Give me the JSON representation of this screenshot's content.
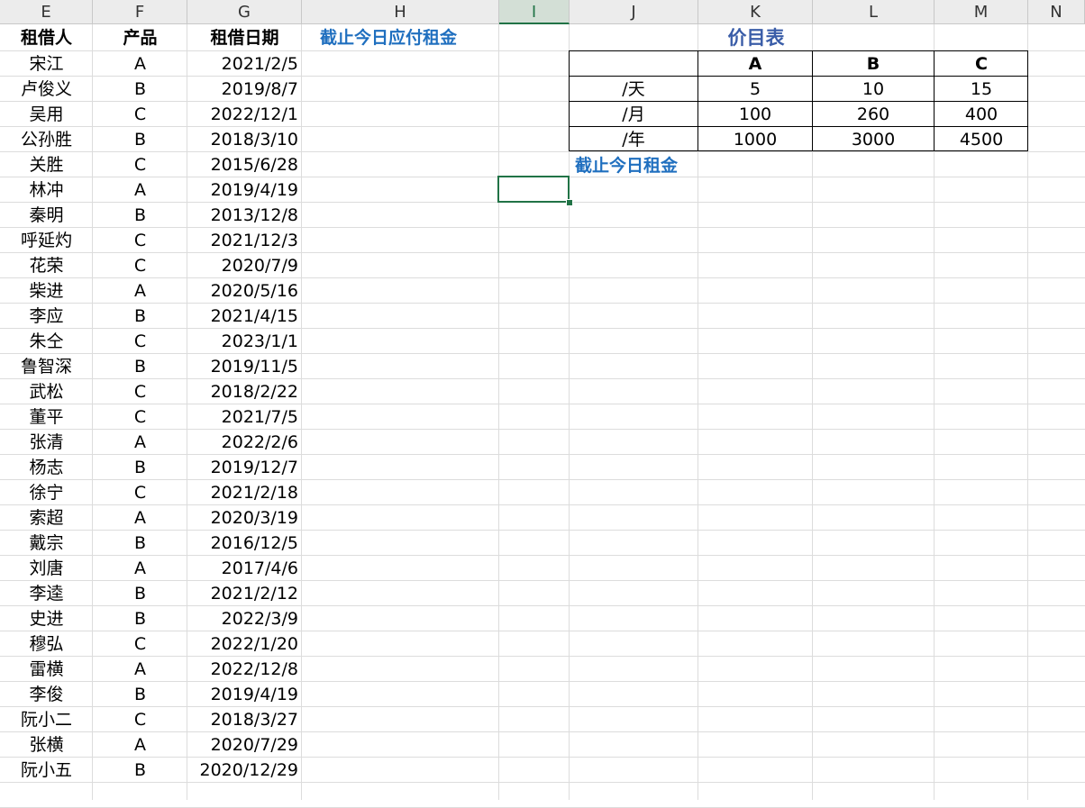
{
  "columns": [
    "E",
    "F",
    "G",
    "H",
    "I",
    "J",
    "K",
    "L",
    "M",
    "N"
  ],
  "headers": {
    "renter": "租借人",
    "product": "产品",
    "date": "租借日期",
    "due_rent_label": "截止今日应付租金",
    "today_rent_label": "截止今日租金"
  },
  "rows": [
    {
      "name": "宋江",
      "product": "A",
      "date": "2021/2/5"
    },
    {
      "name": "卢俊义",
      "product": "B",
      "date": "2019/8/7"
    },
    {
      "name": "吴用",
      "product": "C",
      "date": "2022/12/1"
    },
    {
      "name": "公孙胜",
      "product": "B",
      "date": "2018/3/10"
    },
    {
      "name": "关胜",
      "product": "C",
      "date": "2015/6/28"
    },
    {
      "name": "林冲",
      "product": "A",
      "date": "2019/4/19"
    },
    {
      "name": "秦明",
      "product": "B",
      "date": "2013/12/8"
    },
    {
      "name": "呼延灼",
      "product": "C",
      "date": "2021/12/3"
    },
    {
      "name": "花荣",
      "product": "C",
      "date": "2020/7/9"
    },
    {
      "name": "柴进",
      "product": "A",
      "date": "2020/5/16"
    },
    {
      "name": "李应",
      "product": "B",
      "date": "2021/4/15"
    },
    {
      "name": "朱仝",
      "product": "C",
      "date": "2023/1/1"
    },
    {
      "name": "鲁智深",
      "product": "B",
      "date": "2019/11/5"
    },
    {
      "name": "武松",
      "product": "C",
      "date": "2018/2/22"
    },
    {
      "name": "董平",
      "product": "C",
      "date": "2021/7/5"
    },
    {
      "name": "张清",
      "product": "A",
      "date": "2022/2/6"
    },
    {
      "name": "杨志",
      "product": "B",
      "date": "2019/12/7"
    },
    {
      "name": "徐宁",
      "product": "C",
      "date": "2021/2/18"
    },
    {
      "name": "索超",
      "product": "A",
      "date": "2020/3/19"
    },
    {
      "name": "戴宗",
      "product": "B",
      "date": "2016/12/5"
    },
    {
      "name": "刘唐",
      "product": "A",
      "date": "2017/4/6"
    },
    {
      "name": "李逵",
      "product": "B",
      "date": "2021/2/12"
    },
    {
      "name": "史进",
      "product": "B",
      "date": "2022/3/9"
    },
    {
      "name": "穆弘",
      "product": "C",
      "date": "2022/1/20"
    },
    {
      "name": "雷横",
      "product": "A",
      "date": "2022/12/8"
    },
    {
      "name": "李俊",
      "product": "B",
      "date": "2019/4/19"
    },
    {
      "name": "阮小二",
      "product": "C",
      "date": "2018/3/27"
    },
    {
      "name": "张横",
      "product": "A",
      "date": "2020/7/29"
    },
    {
      "name": "阮小五",
      "product": "B",
      "date": "2020/12/29"
    }
  ],
  "price_table": {
    "title": "价目表",
    "products": [
      "A",
      "B",
      "C"
    ],
    "rows": [
      {
        "label": "/天",
        "values": [
          "5",
          "10",
          "15"
        ]
      },
      {
        "label": "/月",
        "values": [
          "100",
          "260",
          "400"
        ]
      },
      {
        "label": "/年",
        "values": [
          "1000",
          "3000",
          "4500"
        ]
      }
    ]
  },
  "selected_column": "I"
}
